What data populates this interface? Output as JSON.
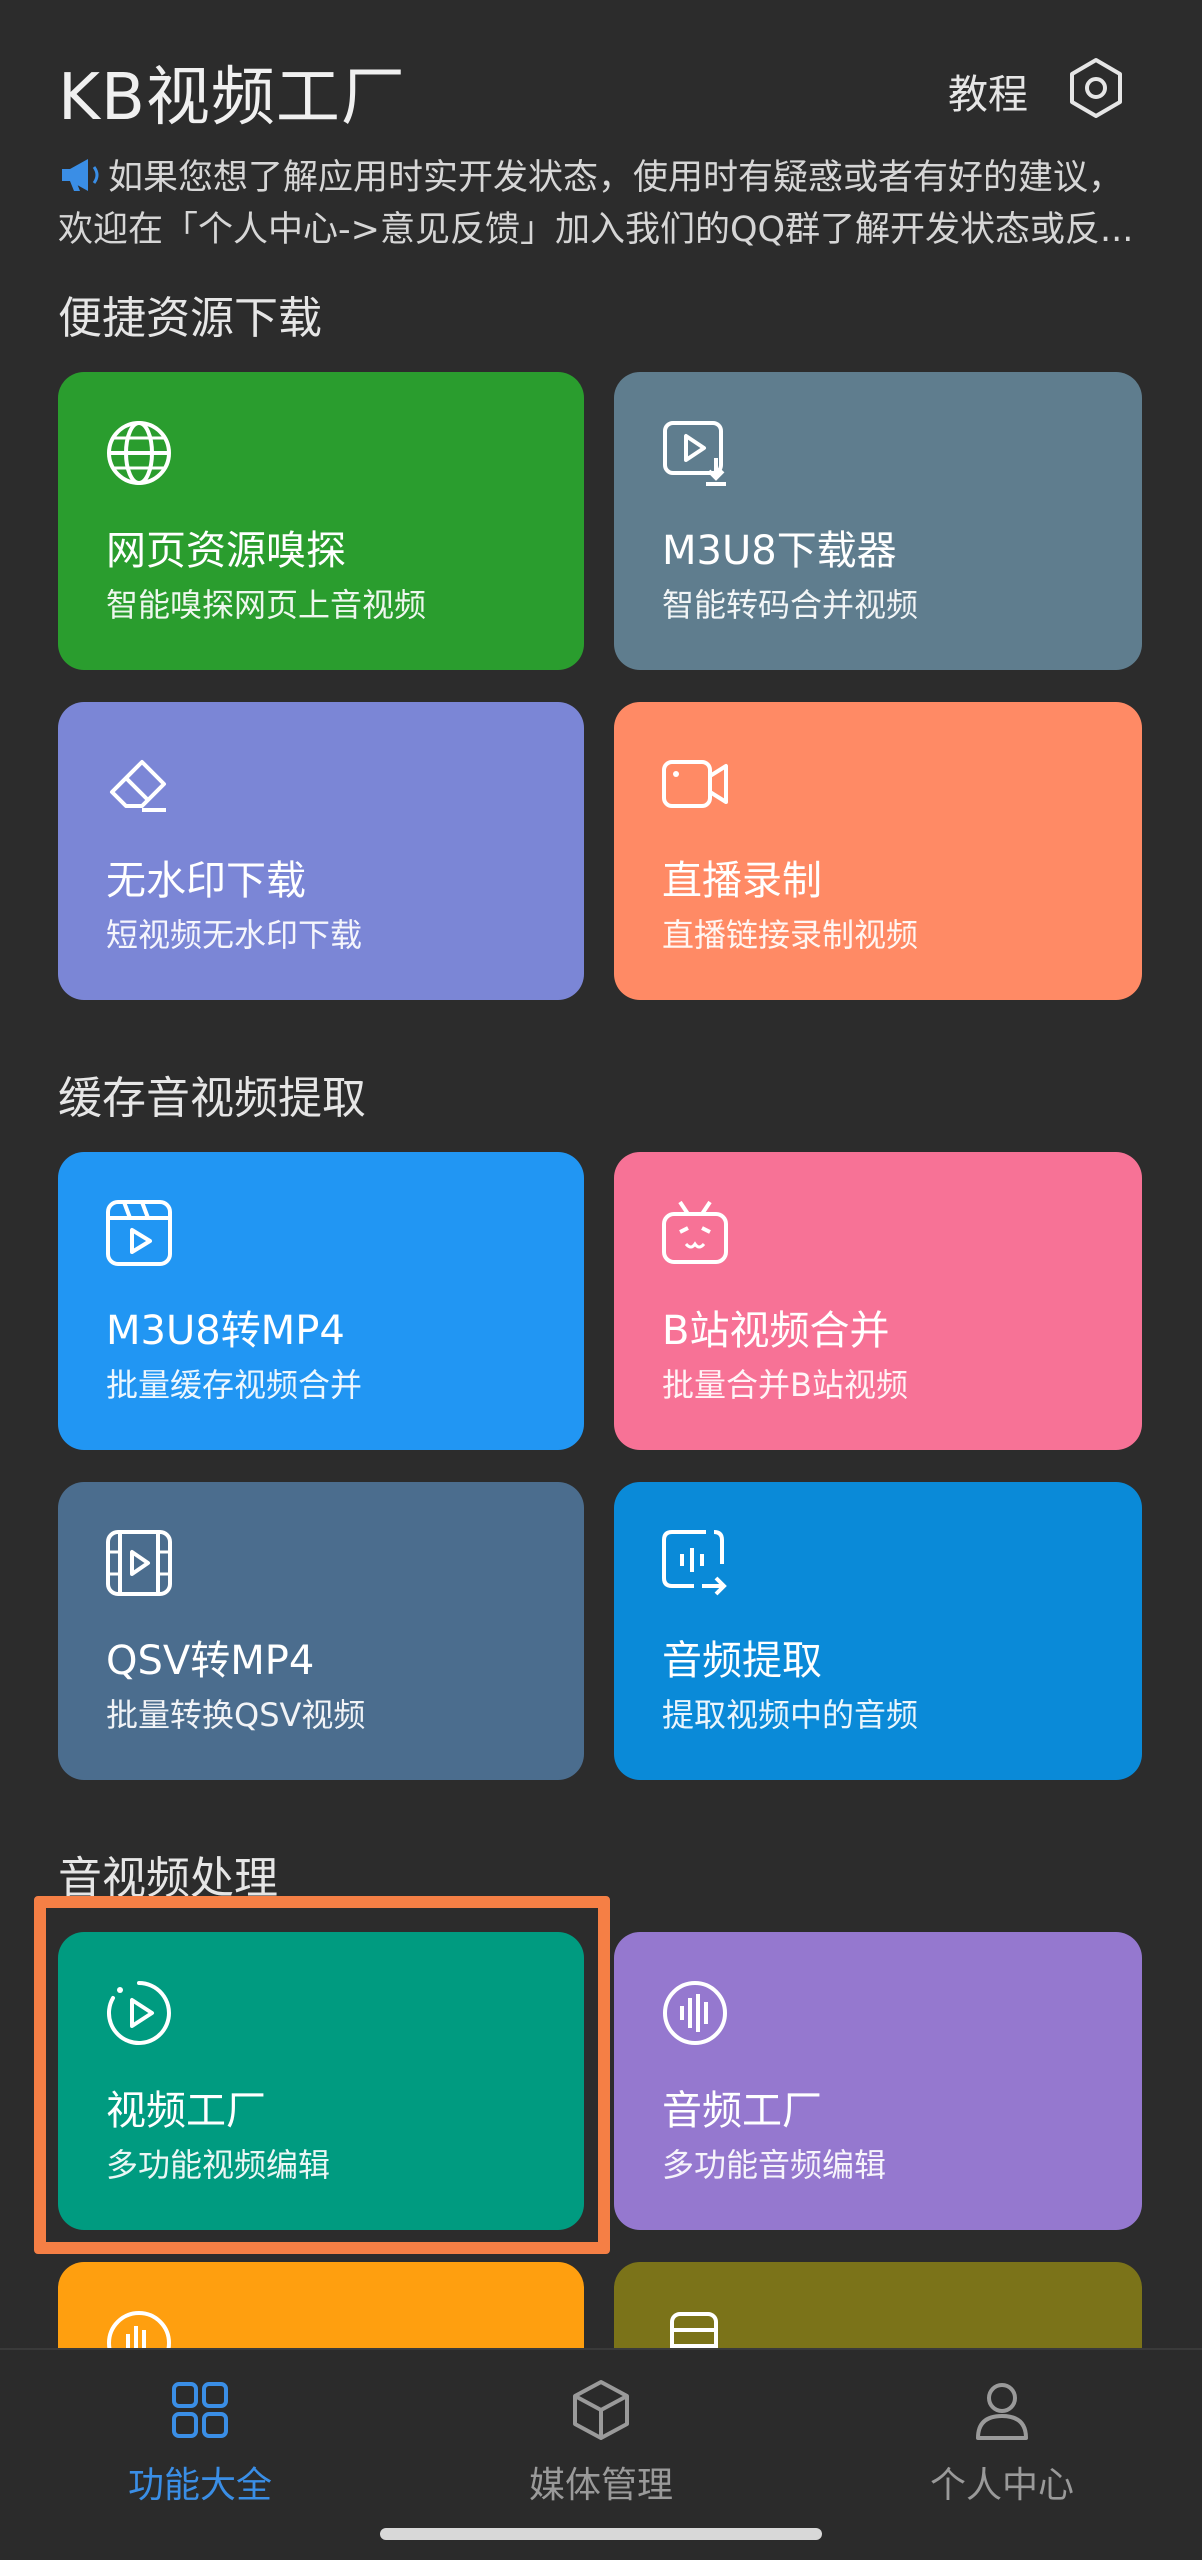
{
  "header": {
    "app_title": "KB视频工厂",
    "tutorial_label": "教程",
    "settings_icon": "gear-hexagon-icon"
  },
  "notice": {
    "icon": "megaphone-icon",
    "line1": "如果您想了解应用时实开发状态，使用时有疑惑或者有好的建议，",
    "line2": "欢迎在「个人中心->意见反馈」加入我们的QQ群了解开发状态或反..."
  },
  "sections": {
    "quick_download": "便捷资源下载",
    "cache_extract": "缓存音视频提取",
    "av_processing": "音视频处理"
  },
  "cards": [
    {
      "title": "网页资源嗅探",
      "subtitle": "智能嗅探网页上音视频",
      "icon": "globe-icon",
      "color": "#2a9d2e"
    },
    {
      "title": "M3U8下载器",
      "subtitle": "智能转码合并视频",
      "icon": "video-download-icon",
      "color": "#5f7d8e"
    },
    {
      "title": "无水印下载",
      "subtitle": "短视频无水印下载",
      "icon": "eraser-icon",
      "color": "#7b86d6"
    },
    {
      "title": "直播录制",
      "subtitle": "直播链接录制视频",
      "icon": "video-camera-icon",
      "color": "#ff8a65"
    },
    {
      "title": "M3U8转MP4",
      "subtitle": "批量缓存视频合并",
      "icon": "clapperboard-icon",
      "color": "#2196f3"
    },
    {
      "title": "B站视频合并",
      "subtitle": "批量合并B站视频",
      "icon": "bilibili-tv-icon",
      "color": "#f77296"
    },
    {
      "title": "QSV转MP4",
      "subtitle": "批量转换QSV视频",
      "icon": "film-strip-icon",
      "color": "#4b6d8e"
    },
    {
      "title": "音频提取",
      "subtitle": "提取视频中的音频",
      "icon": "audio-extract-icon",
      "color": "#0a8ad8"
    },
    {
      "title": "视频工厂",
      "subtitle": "多功能视频编辑",
      "icon": "play-circle-icon",
      "color": "#009b80"
    },
    {
      "title": "音频工厂",
      "subtitle": "多功能音频编辑",
      "icon": "audio-wave-circle-icon",
      "color": "#9578cf"
    },
    {
      "icon": "audio-wave-circle-icon",
      "color": "#ff9f0f"
    },
    {
      "icon": "film-strip-icon",
      "color": "#7b7319"
    }
  ],
  "bottom_nav": {
    "items": [
      {
        "label": "功能大全",
        "icon": "grid-apps-icon"
      },
      {
        "label": "媒体管理",
        "icon": "cube-icon"
      },
      {
        "label": "个人中心",
        "icon": "person-icon"
      }
    ],
    "active_color": "#3a8ee6",
    "inactive_color": "#9a9a9a"
  }
}
